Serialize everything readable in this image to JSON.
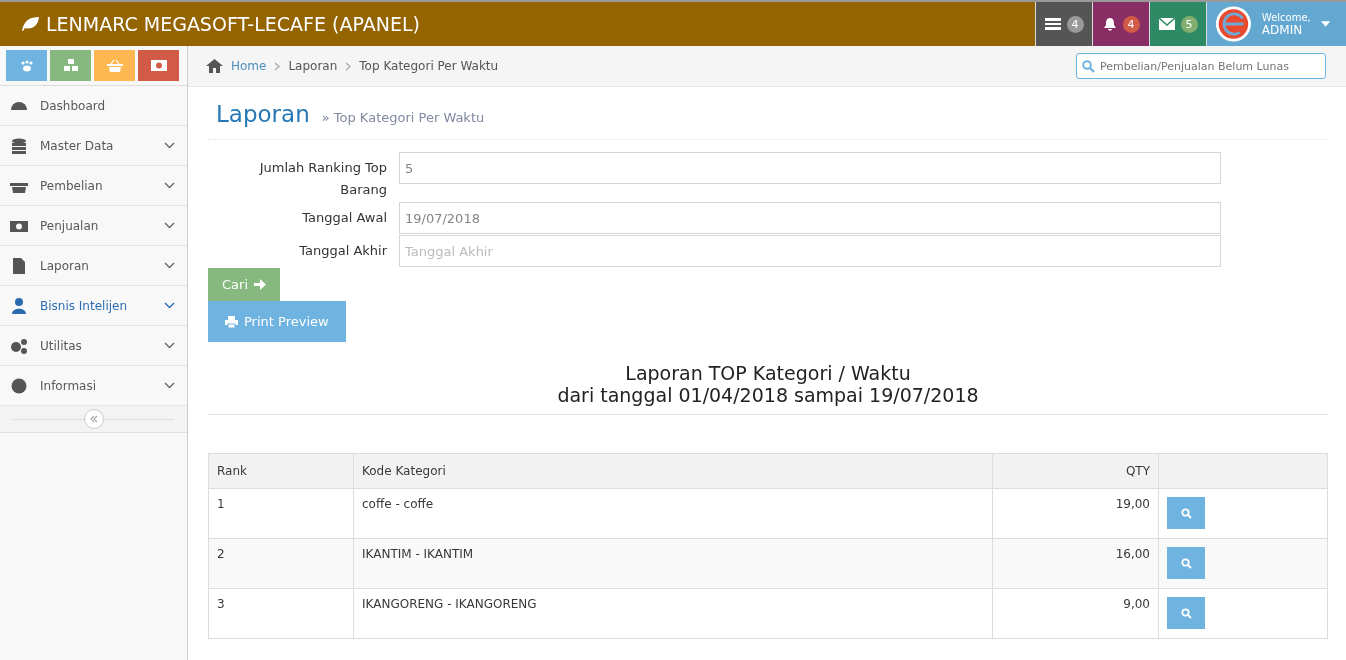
{
  "header": {
    "title": "LENMARC MEGASOFT-LECAFE (APANEL)",
    "badges": [
      {
        "count": "4",
        "color": "#999999"
      },
      {
        "count": "4",
        "color": "#d15b47"
      },
      {
        "count": "5",
        "color": "#82af6f"
      }
    ],
    "user": {
      "greeting": "Welcome,",
      "name": "ADMIN"
    }
  },
  "sidebar": {
    "items": [
      {
        "label": "Dashboard",
        "has_submenu": false,
        "selected": false
      },
      {
        "label": "Master Data",
        "has_submenu": true,
        "selected": false
      },
      {
        "label": "Pembelian",
        "has_submenu": true,
        "selected": false
      },
      {
        "label": "Penjualan",
        "has_submenu": true,
        "selected": false
      },
      {
        "label": "Laporan",
        "has_submenu": true,
        "selected": false
      },
      {
        "label": "Bisnis Intelijen",
        "has_submenu": true,
        "selected": true
      },
      {
        "label": "Utilitas",
        "has_submenu": true,
        "selected": false
      },
      {
        "label": "Informasi",
        "has_submenu": true,
        "selected": false
      }
    ]
  },
  "breadcrumb": [
    "Home",
    "Laporan",
    "Top Kategori Per Waktu"
  ],
  "search": {
    "placeholder": "Pembelian/Penjualan Belum Lunas"
  },
  "page_header": {
    "title": "Laporan",
    "subtitle": "» Top Kategori Per Waktu"
  },
  "form": {
    "fields": [
      {
        "label": "Jumlah Ranking Top Barang",
        "value": "5"
      },
      {
        "label": "Tanggal Awal",
        "value": "19/07/2018"
      },
      {
        "label": "Tanggal Akhir",
        "placeholder": "Tanggal Akhir"
      }
    ],
    "buttons": [
      "Cari",
      "Print Preview"
    ]
  },
  "report": {
    "title": "Laporan TOP Kategori / Waktu",
    "subtitle": "dari tanggal 01/04/2018 sampai 19/07/2018"
  },
  "table": {
    "columns": [
      "Rank",
      "Kode Kategori",
      "QTY"
    ],
    "rows": [
      {
        "rank": "1",
        "kode": "coffe - coffe",
        "qty": "19,00"
      },
      {
        "rank": "2",
        "kode": "IKANTIM - IKANTIM",
        "qty": "16,00"
      },
      {
        "rank": "3",
        "kode": "IKANGORENG - IKANGORENG",
        "qty": "9,00"
      }
    ]
  }
}
